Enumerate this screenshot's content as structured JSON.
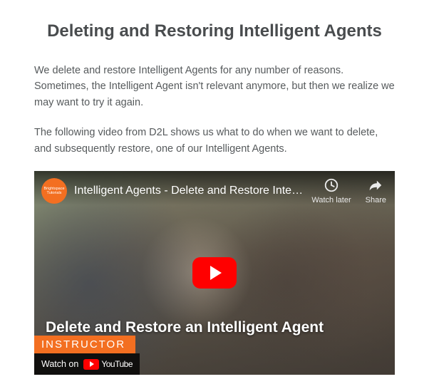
{
  "title": "Deleting and Restoring Intelligent Agents",
  "intro": "We delete and restore Intelligent Agents for any number of reasons. Sometimes, the Intelligent Agent isn't relevant anymore, but then we realize we may want to try it again.",
  "second": "The following video from D2L shows us what to do when we want to delete, and subsequently restore, one of our Intelligent Agents.",
  "video": {
    "channel_avatar_text": "Brightspace Tutorials",
    "title": "Intelligent Agents - Delete and Restore Intelligent Age...",
    "watch_later": "Watch later",
    "share": "Share",
    "caption": "Delete and Restore an Intelligent Agent",
    "badge": "INSTRUCTOR",
    "watch_on": "Watch on",
    "youtube": "YouTube"
  }
}
